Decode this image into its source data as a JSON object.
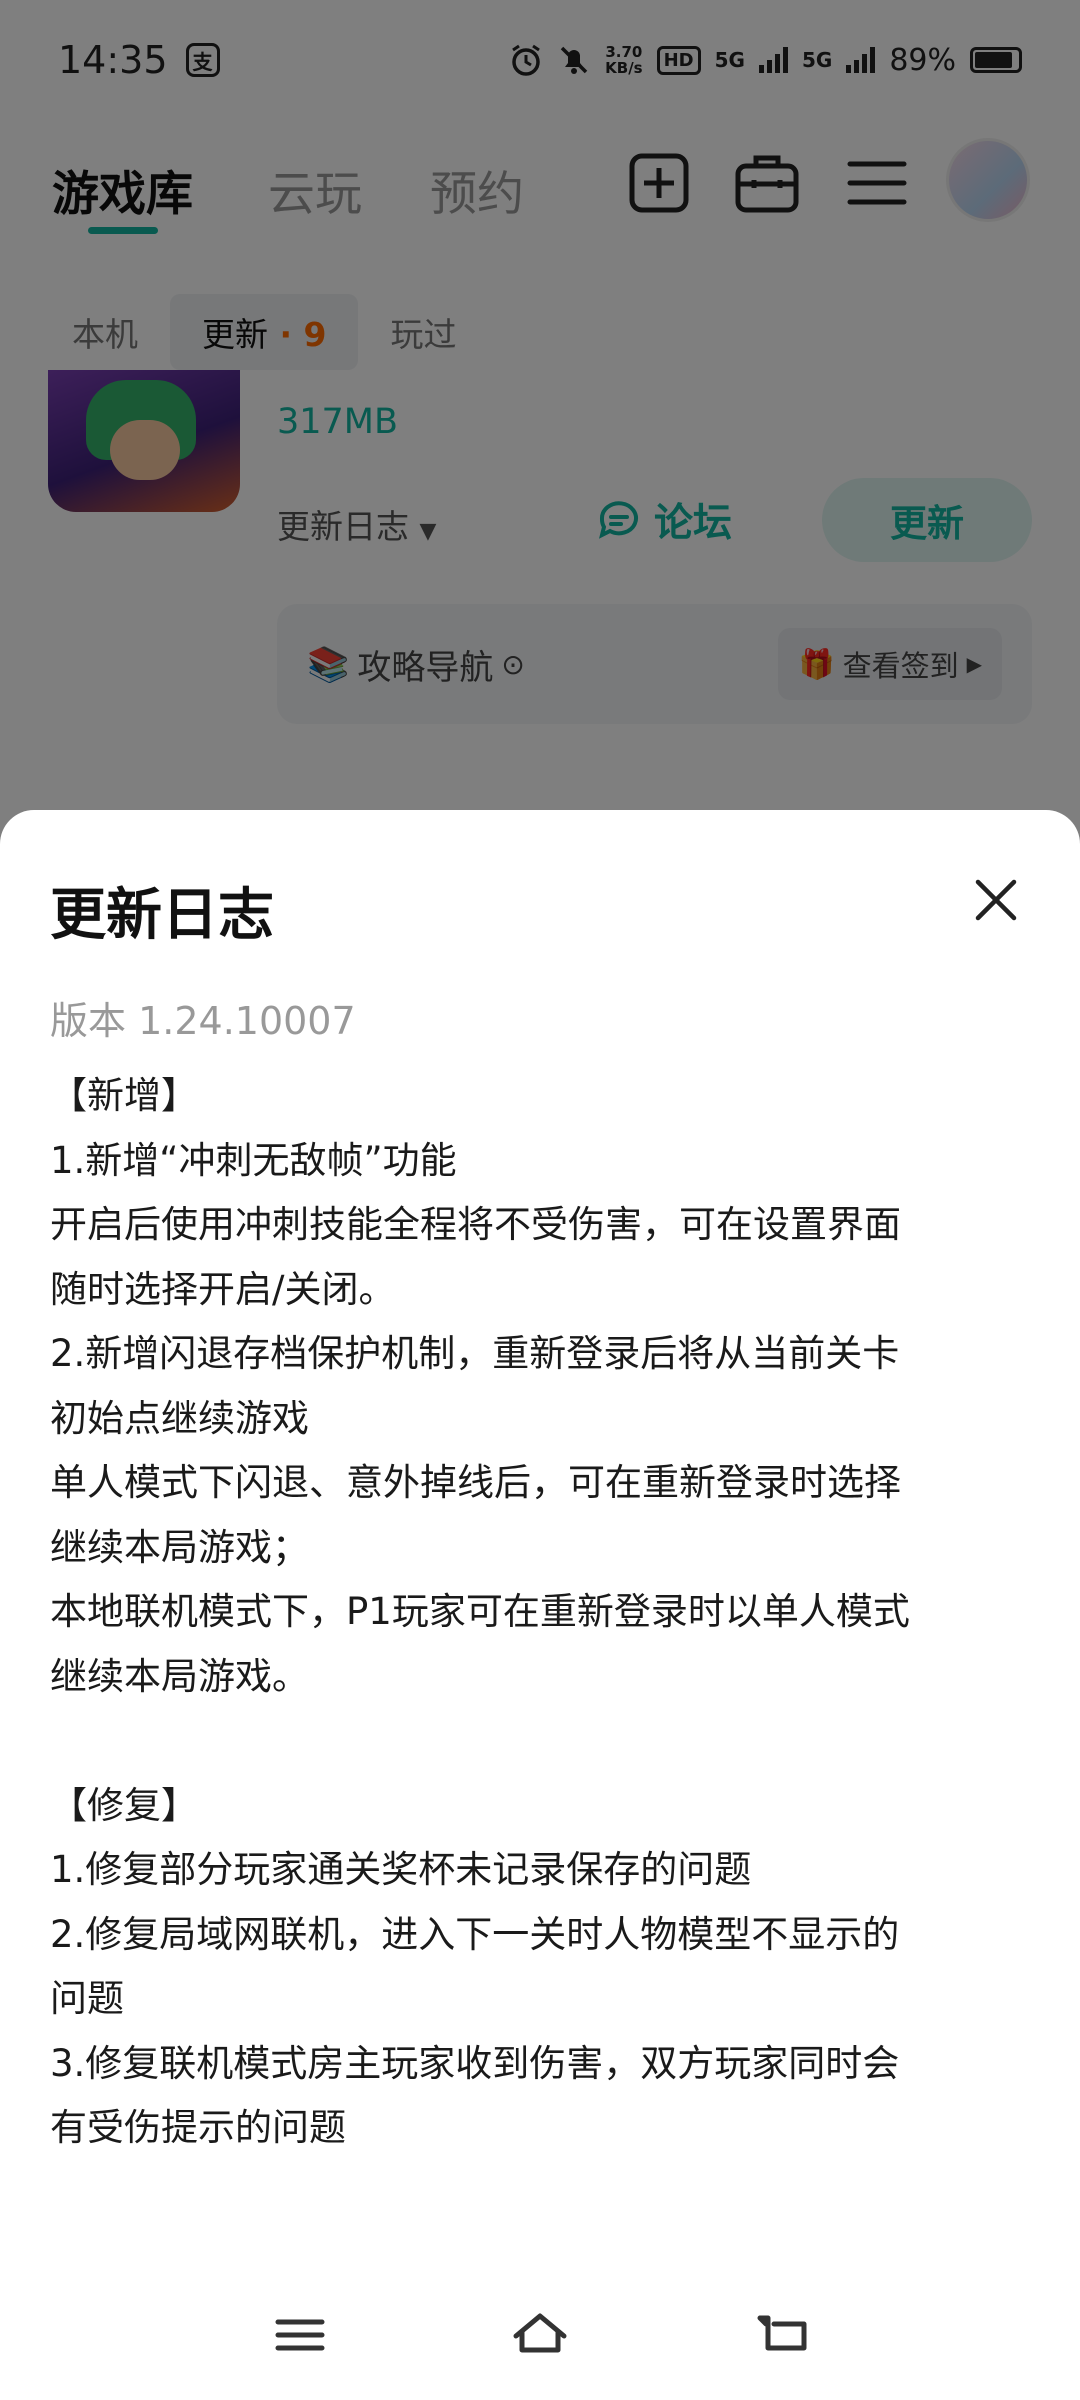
{
  "status": {
    "time": "14:35",
    "pay_badge": "支",
    "speed_value": "3.70",
    "speed_unit": "KB/s",
    "hd": "HD",
    "net1": "5G",
    "net2": "5G",
    "battery": "89%",
    "battery_level": 0.89
  },
  "header": {
    "tabs": [
      {
        "label": "游戏库"
      },
      {
        "label": "云玩"
      },
      {
        "label": "预约"
      }
    ],
    "icons": [
      "add-icon",
      "toolbox-icon",
      "menu-icon"
    ]
  },
  "sub_tabs": [
    {
      "label": "本机"
    },
    {
      "label": "更新",
      "count": "9"
    },
    {
      "label": "玩过"
    }
  ],
  "game": {
    "size": "317MB",
    "changelog_label": "更新日志",
    "forum_label": "论坛",
    "update_label": "更新",
    "guide_label": "攻略导航",
    "checkin_label": "查看签到"
  },
  "sheet": {
    "title": "更新日志",
    "version": "版本 1.24.10007",
    "lines": [
      "【新增】",
      "1.新增“冲刺无敌帧”功能",
      "开启后使用冲刺技能全程将不受伤害，可在设置界面",
      "随时选择开启/关闭。",
      "2.新增闪退存档保护机制，重新登录后将从当前关卡",
      "初始点继续游戏",
      "单人模式下闪退、意外掉线后，可在重新登录时选择",
      "继续本局游戏；",
      "本地联机模式下，P1玩家可在重新登录时以单人模式",
      "继续本局游戏。",
      "",
      "【修复】",
      "1.修复部分玩家通关奖杯未记录保存的问题",
      "2.修复局域网联机，进入下一关时人物模型不显示的",
      "问题",
      "3.修复联机模式房主玩家收到伤害，双方玩家同时会",
      "有受伤提示的问题"
    ]
  },
  "nav": [
    "menu-icon",
    "home-icon",
    "back-icon"
  ],
  "colors": {
    "accent": "#12b5a0",
    "count": "#ff6a00"
  }
}
